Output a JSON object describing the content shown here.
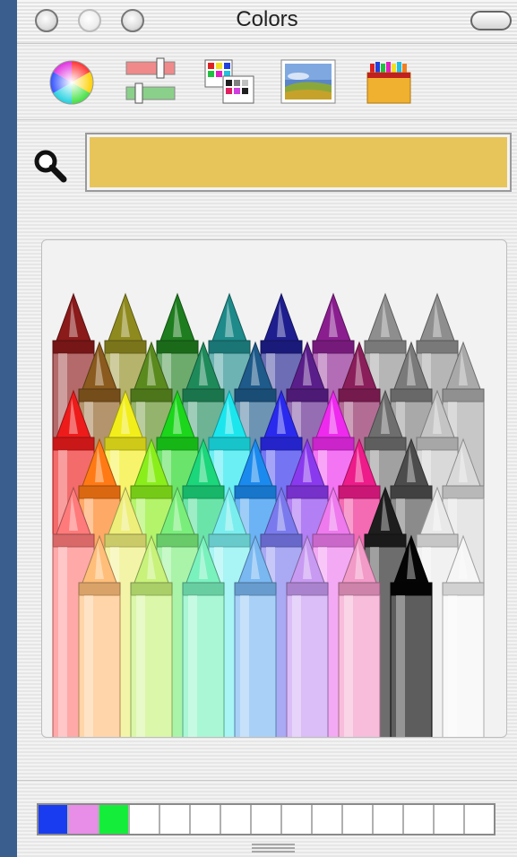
{
  "window": {
    "title": "Colors",
    "buttons": [
      "close-button",
      "minimize-button",
      "zoom-button"
    ]
  },
  "toolbar": {
    "tools": [
      {
        "name": "color-wheel",
        "icon": "color-wheel-icon"
      },
      {
        "name": "color-sliders",
        "icon": "sliders-icon"
      },
      {
        "name": "color-palettes",
        "icon": "palette-icon"
      },
      {
        "name": "image-palettes",
        "icon": "landscape-image-icon"
      },
      {
        "name": "crayons",
        "icon": "crayon-box-icon",
        "selected": true
      }
    ]
  },
  "color_well": {
    "color": "#e8c55a",
    "magnifier_icon": "search-icon"
  },
  "crayons": {
    "rows": [
      [
        "#8b1a1a",
        "#8f8a1e",
        "#1e7d1e",
        "#1e8a8a",
        "#1e1e8f",
        "#8a1e8f",
        "#8e8e8e",
        "#8e8e8e"
      ],
      [
        "#8a5a1e",
        "#5a8a1e",
        "#1e8a5a",
        "#1e5a8a",
        "#5a1e8a",
        "#8a1e5a",
        "#7a7a7a",
        "#a9a9a9"
      ],
      [
        "#ee1b1b",
        "#f2ee1b",
        "#1bd61b",
        "#1be6ee",
        "#2a2aee",
        "#ee2aee",
        "#6e6e6e",
        "#c4c4c4"
      ],
      [
        "#ff7a14",
        "#8aee1b",
        "#1bd67a",
        "#1b8aee",
        "#8a3aee",
        "#ee1b8a",
        "#4c4c4c",
        "#d9d9d9"
      ],
      [
        "#ff7a7a",
        "#eeee7a",
        "#7aee7a",
        "#7aeeee",
        "#7a7aee",
        "#ee7aee",
        "#1e1e1e",
        "#e9e9e9"
      ],
      [
        "#ffbe7a",
        "#c8f27a",
        "#7af2be",
        "#7ab8f2",
        "#c89af2",
        "#f29ac8",
        "#050505",
        "#f6f6f6"
      ]
    ]
  },
  "swatches": {
    "colors": [
      "#1a3cf0",
      "#e88ee8",
      "#14ee3a",
      "#ffffff",
      "#ffffff",
      "#ffffff",
      "#ffffff",
      "#ffffff",
      "#ffffff",
      "#ffffff",
      "#ffffff",
      "#ffffff",
      "#ffffff",
      "#ffffff",
      "#ffffff"
    ]
  }
}
